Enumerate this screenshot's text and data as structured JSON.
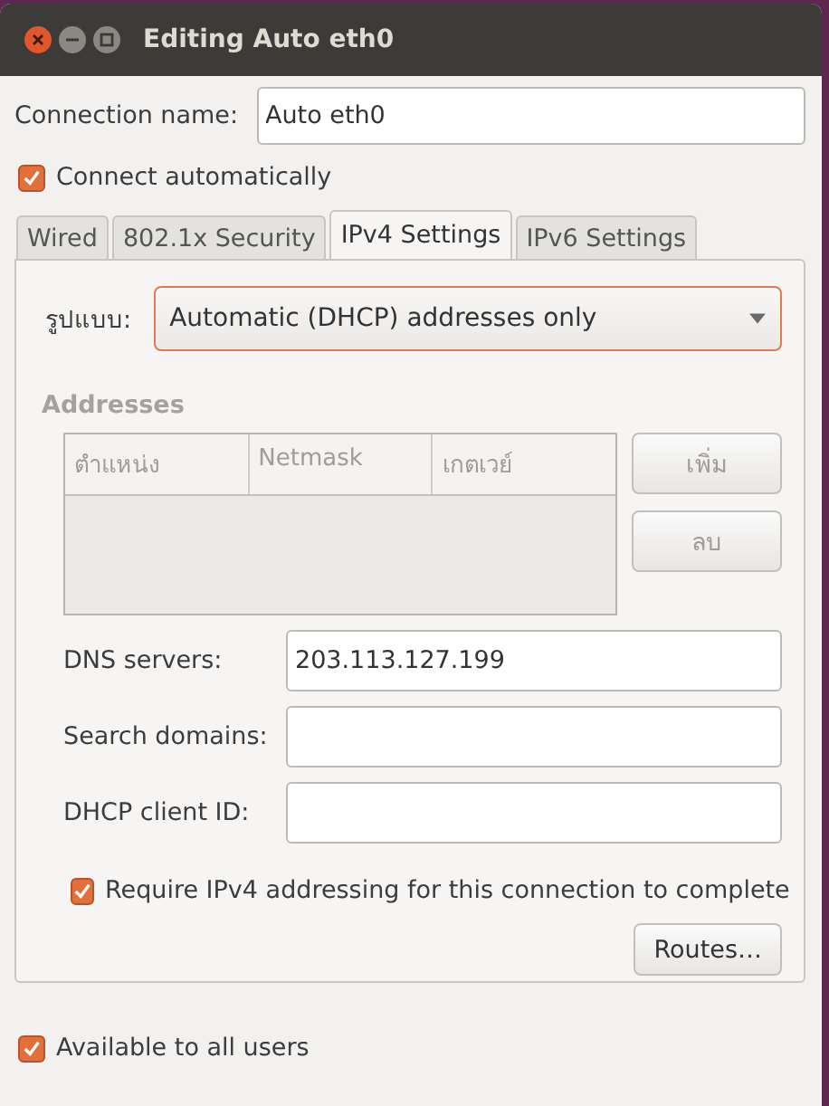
{
  "window": {
    "title": "Editing Auto eth0",
    "buttons": [
      {
        "kind": "close"
      },
      {
        "kind": "minimize"
      },
      {
        "kind": "maximize"
      }
    ]
  },
  "connection_name": {
    "label": "Connection name:",
    "value": "Auto eth0"
  },
  "connect_automatically": {
    "label": "Connect automatically",
    "checked": true
  },
  "tabs": [
    {
      "label": "Wired",
      "selected": false
    },
    {
      "label": "802.1x Security",
      "selected": false
    },
    {
      "label": "IPv4 Settings",
      "selected": true
    },
    {
      "label": "IPv6 Settings",
      "selected": false
    }
  ],
  "method": {
    "label": "รูปแบบ:",
    "value": "Automatic (DHCP) addresses only"
  },
  "addresses": {
    "title": "Addresses",
    "disabled": true,
    "columns": [
      "ตำแหน่ง",
      "Netmask",
      "เกตเวย์"
    ],
    "buttons": [
      "เพิ่ม",
      "ลบ"
    ]
  },
  "fields": [
    {
      "label": "DNS servers:",
      "value": "203.113.127.199"
    },
    {
      "label": "Search domains:"
    },
    {
      "label": "DHCP client ID:"
    }
  ],
  "require_ipv4": {
    "label": "Require IPv4 addressing for this connection to complete",
    "checked": true
  },
  "routes_button": "Routes…",
  "available_to_all": {
    "label": "Available to all users",
    "checked": true
  }
}
